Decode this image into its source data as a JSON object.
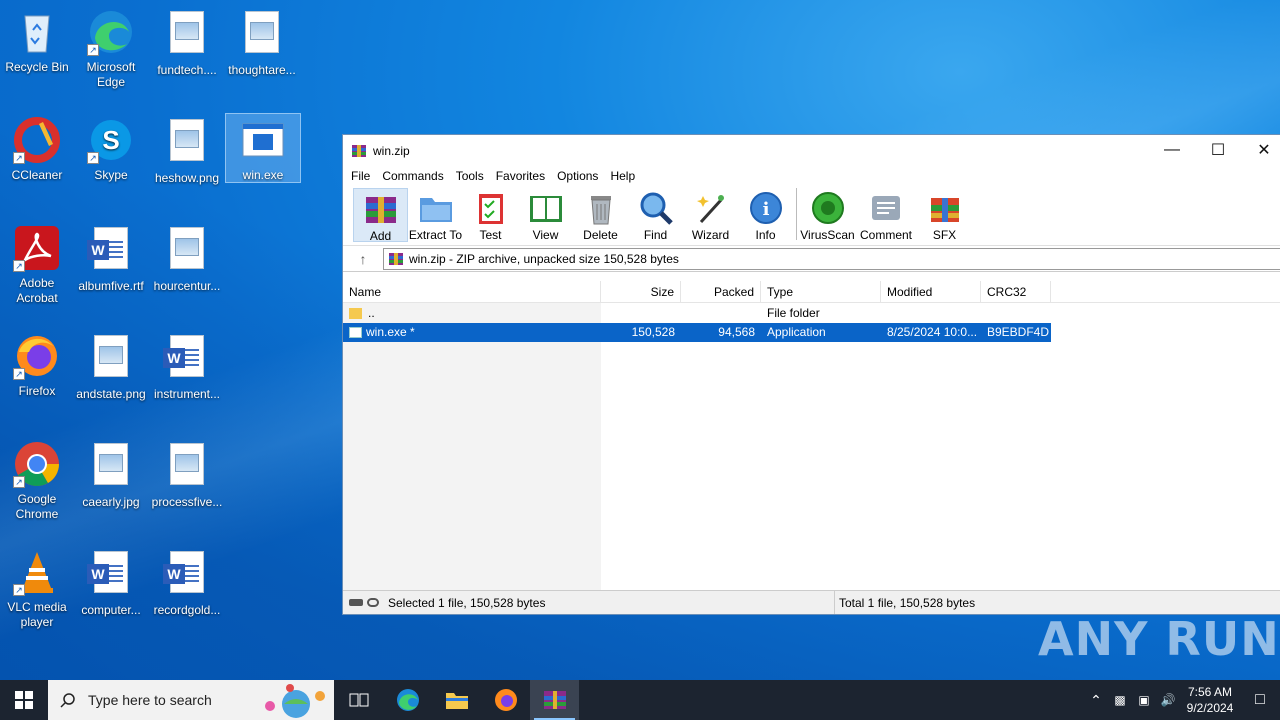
{
  "desktop": {
    "icons": [
      {
        "label": "Recycle Bin"
      },
      {
        "label": "Microsoft Edge"
      },
      {
        "label": "fundtech...."
      },
      {
        "label": "thoughtare..."
      },
      {
        "label": "CCleaner"
      },
      {
        "label": "Skype"
      },
      {
        "label": "heshow.png"
      },
      {
        "label": "win.exe"
      },
      {
        "label": "Adobe Acrobat"
      },
      {
        "label": "albumfive.rtf"
      },
      {
        "label": "hourcentur..."
      },
      {
        "label": "Firefox"
      },
      {
        "label": "andstate.png"
      },
      {
        "label": "instrument..."
      },
      {
        "label": "Google Chrome"
      },
      {
        "label": "caearly.jpg"
      },
      {
        "label": "processfive..."
      },
      {
        "label": "VLC media player"
      },
      {
        "label": "computer..."
      },
      {
        "label": "recordgold..."
      }
    ]
  },
  "window": {
    "title": "win.zip",
    "menu": [
      "File",
      "Commands",
      "Tools",
      "Favorites",
      "Options",
      "Help"
    ],
    "toolbar": [
      "Add",
      "Extract To",
      "Test",
      "View",
      "Delete",
      "Find",
      "Wizard",
      "Info",
      "VirusScan",
      "Comment",
      "SFX"
    ],
    "path": "win.zip - ZIP archive, unpacked size 150,528 bytes",
    "columns": {
      "name": "Name",
      "size": "Size",
      "packed": "Packed",
      "type": "Type",
      "modified": "Modified",
      "crc": "CRC32"
    },
    "rows": [
      {
        "name": "..",
        "size": "",
        "packed": "",
        "type": "File folder",
        "modified": "",
        "crc": ""
      },
      {
        "name": "win.exe *",
        "size": "150,528",
        "packed": "94,568",
        "type": "Application",
        "modified": "8/25/2024 10:0...",
        "crc": "B9EBDF4D"
      }
    ],
    "status_left": "Selected 1 file, 150,528 bytes",
    "status_right": "Total 1 file, 150,528 bytes"
  },
  "watermark": "ANY RUN",
  "taskbar": {
    "search_placeholder": "Type here to search",
    "time": "7:56 AM",
    "date": "9/2/2024"
  }
}
